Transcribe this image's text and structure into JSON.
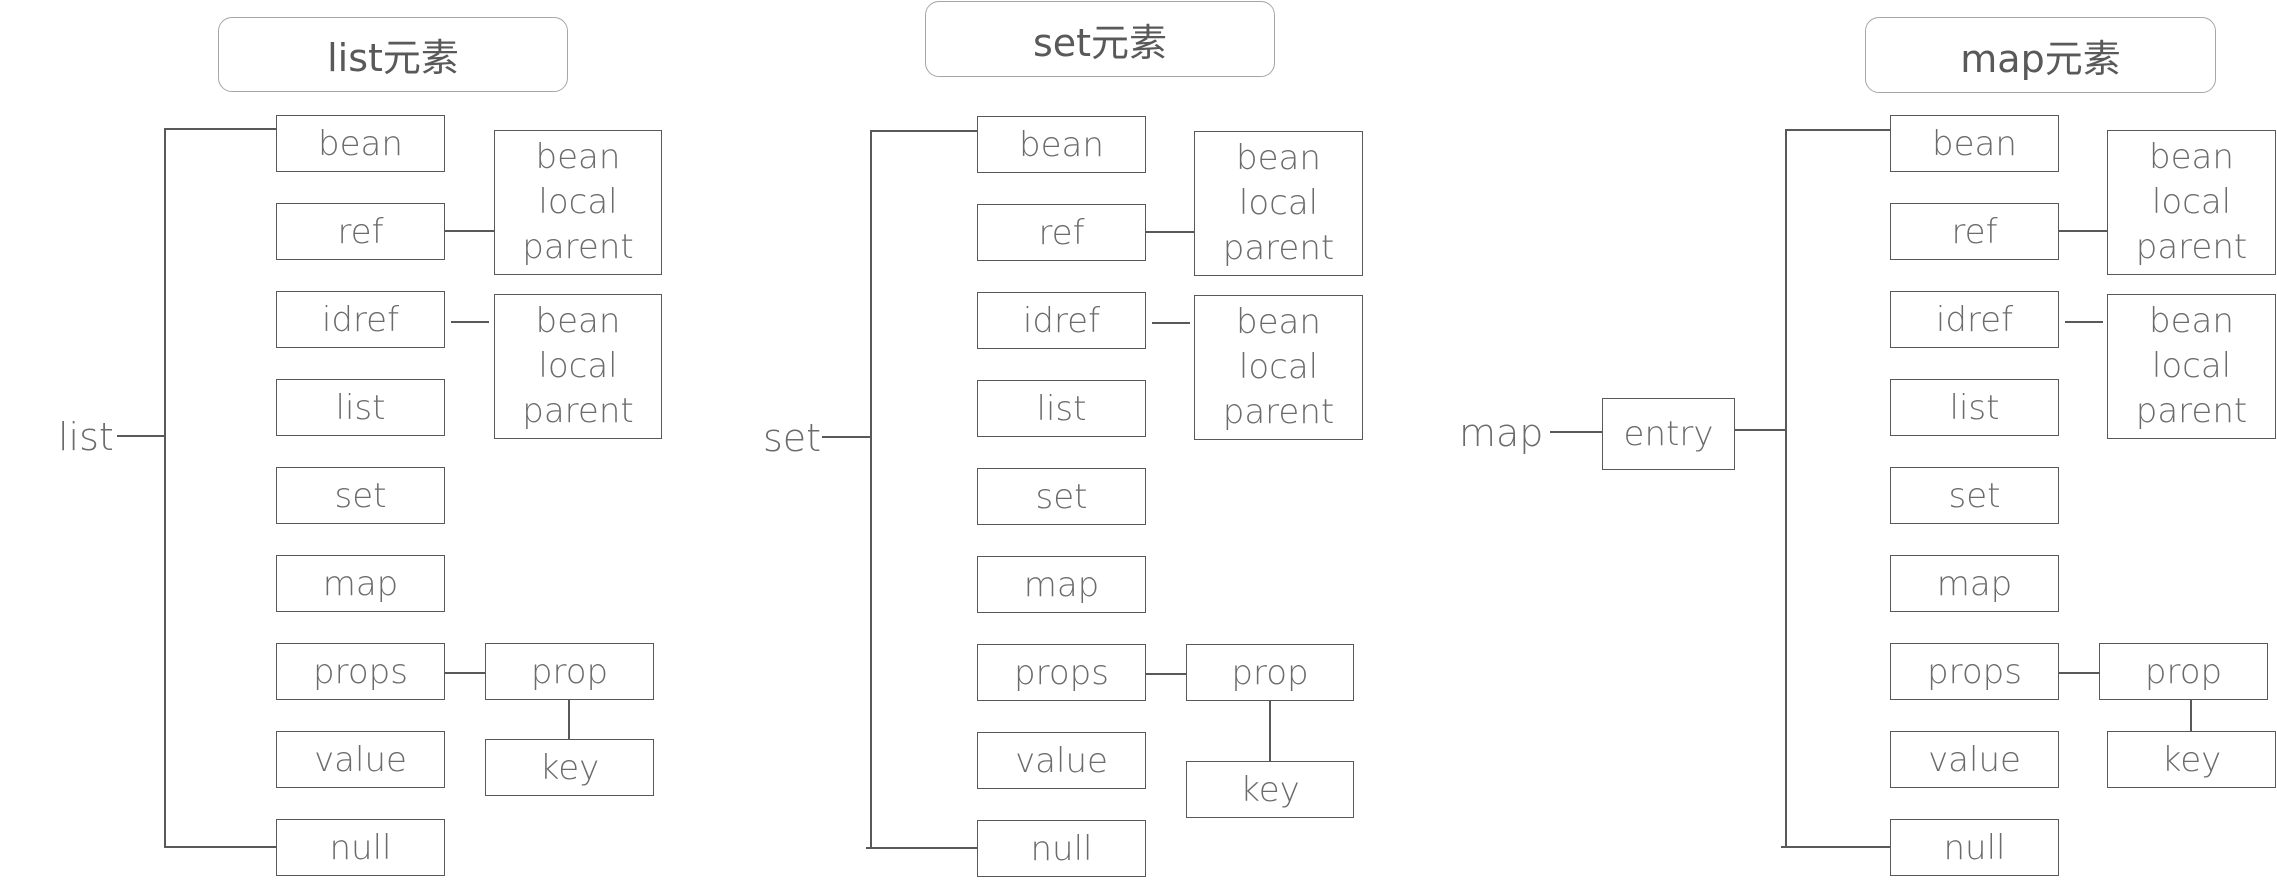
{
  "panels": [
    {
      "title": "list元素",
      "root": "list",
      "children": [
        "bean",
        "ref",
        "idref",
        "list",
        "set",
        "map",
        "props",
        "value",
        "null"
      ],
      "ref_targets": [
        "bean",
        "local",
        "parent"
      ],
      "idref_targets": [
        "bean",
        "local",
        "parent"
      ],
      "props_child": "prop",
      "prop_child": "key"
    },
    {
      "title": "set元素",
      "root": "set",
      "children": [
        "bean",
        "ref",
        "idref",
        "list",
        "set",
        "map",
        "props",
        "value",
        "null"
      ],
      "ref_targets": [
        "bean",
        "local",
        "parent"
      ],
      "idref_targets": [
        "bean",
        "local",
        "parent"
      ],
      "props_child": "prop",
      "prop_child": "key"
    },
    {
      "title": "map元素",
      "root": "map",
      "intermediate": "entry",
      "children": [
        "bean",
        "ref",
        "idref",
        "list",
        "set",
        "map",
        "props",
        "value",
        "null"
      ],
      "ref_targets": [
        "bean",
        "local",
        "parent"
      ],
      "idref_targets": [
        "bean",
        "local",
        "parent"
      ],
      "props_child": "prop",
      "prop_child": "key"
    }
  ],
  "colors": {
    "line": "#595959",
    "text": "#6b6b6b",
    "title_border": "#a6a6a6"
  }
}
